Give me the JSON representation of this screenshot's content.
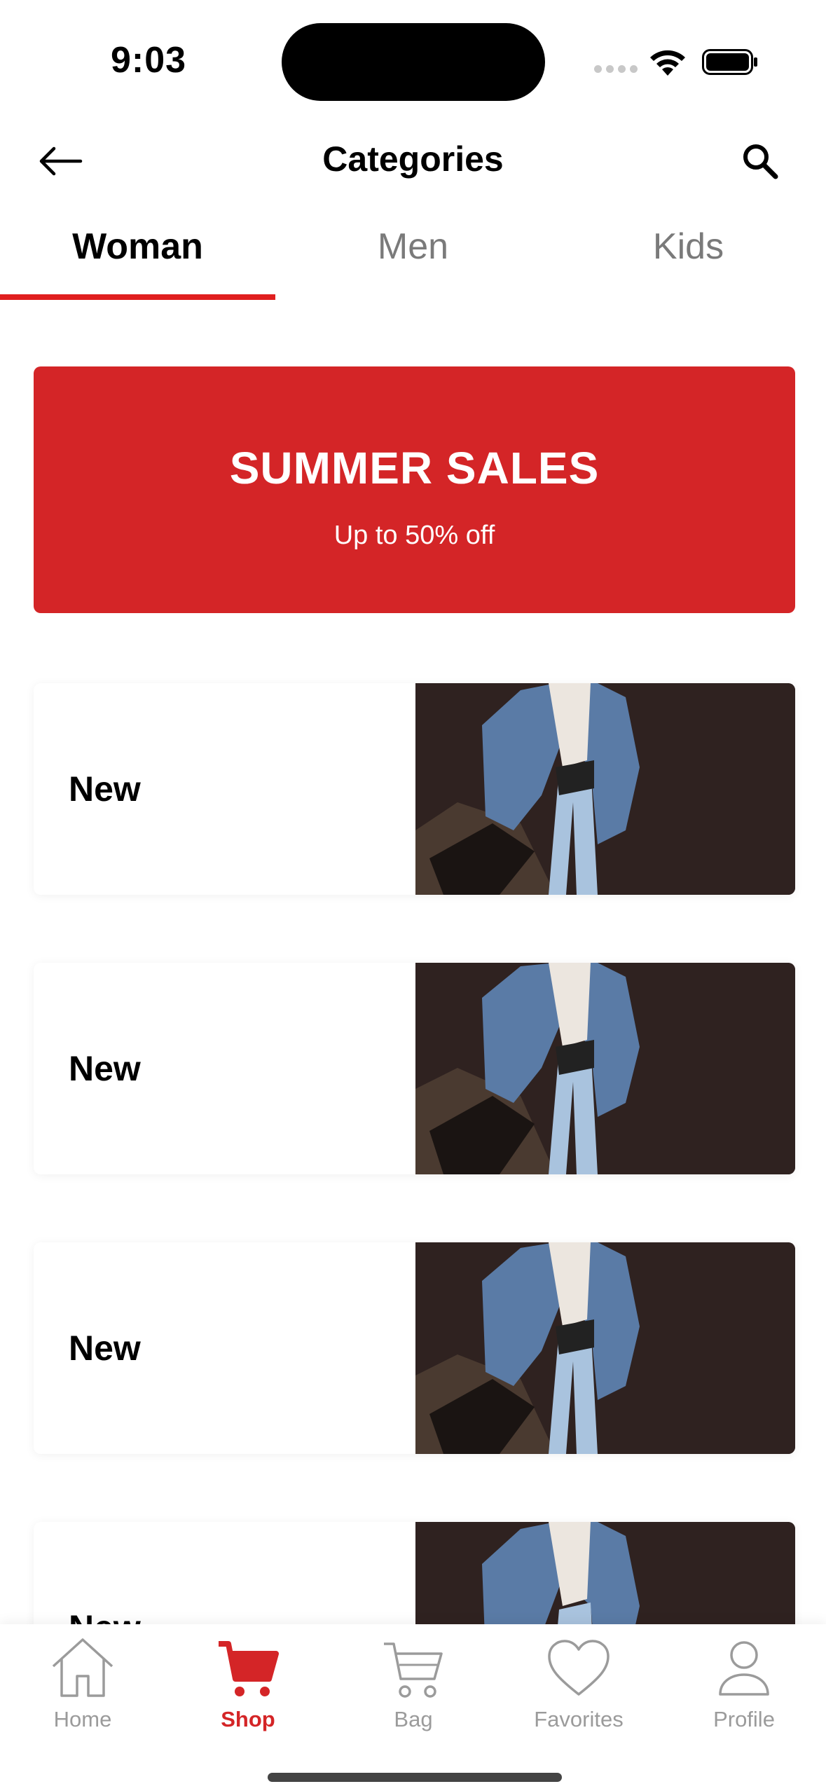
{
  "status_bar": {
    "time": "9:03"
  },
  "header": {
    "title": "Categories",
    "back_icon": "arrow-left-icon",
    "search_icon": "search-icon"
  },
  "tabs": [
    {
      "label": "Woman",
      "active": true
    },
    {
      "label": "Men",
      "active": false
    },
    {
      "label": "Kids",
      "active": false
    }
  ],
  "banner": {
    "title": "SUMMER SALES",
    "subtitle": "Up to 50% off",
    "color": "#d42527"
  },
  "categories": [
    {
      "label": "New",
      "image": "denim-jacket-photo"
    },
    {
      "label": "New",
      "image": "denim-jacket-photo"
    },
    {
      "label": "New",
      "image": "denim-jacket-photo"
    },
    {
      "label": "New",
      "image": "denim-jacket-photo"
    }
  ],
  "bottom_nav": [
    {
      "label": "Home",
      "icon": "home-icon",
      "active": false
    },
    {
      "label": "Shop",
      "icon": "cart-icon",
      "active": true
    },
    {
      "label": "Bag",
      "icon": "bag-cart-icon",
      "active": false
    },
    {
      "label": "Favorites",
      "icon": "heart-icon",
      "active": false
    },
    {
      "label": "Profile",
      "icon": "profile-icon",
      "active": false
    }
  ],
  "colors": {
    "accent": "#d42527",
    "inactive": "#9b9b9b"
  }
}
